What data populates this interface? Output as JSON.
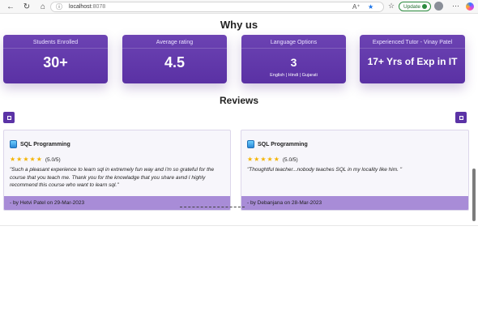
{
  "browser": {
    "url_host": "localhost",
    "url_port": ":8078",
    "update_label": "Update"
  },
  "why_us": {
    "title": "Why us",
    "stats": [
      {
        "label": "Students Enrolled",
        "value": "30+"
      },
      {
        "label": "Average rating",
        "value": "4.5"
      },
      {
        "label": "Language Options",
        "value": "3",
        "sub": "English | Hindi | Gujarati"
      },
      {
        "label": "Experienced Tutor - Vinay Patel",
        "value": "17+ Yrs of Exp in IT"
      }
    ]
  },
  "reviews": {
    "title": "Reviews",
    "cards": [
      {
        "course": "SQL Programming",
        "stars": 5,
        "score": "(5.0/5)",
        "text": "\"Such a pleasant experience to learn sql in extremely fun way and i'm so grateful for the course that you teach me. Thank you for the knowladge that you share avnd I highly recommend this course who want to learn sql.\"",
        "footer": "- by Hetvi Patel on 29-Mar-2023"
      },
      {
        "course": "SQL Programming",
        "stars": 5,
        "score": "(5.0/5)",
        "text": "\"Thoughtful teacher...nobody teaches SQL in my locality like him. \"",
        "footer": "- by Debanjana on 28-Mar-2023"
      }
    ]
  },
  "colors": {
    "accent": "#5b33a6",
    "card_footer": "#a88cd7",
    "star": "#f4b400"
  }
}
